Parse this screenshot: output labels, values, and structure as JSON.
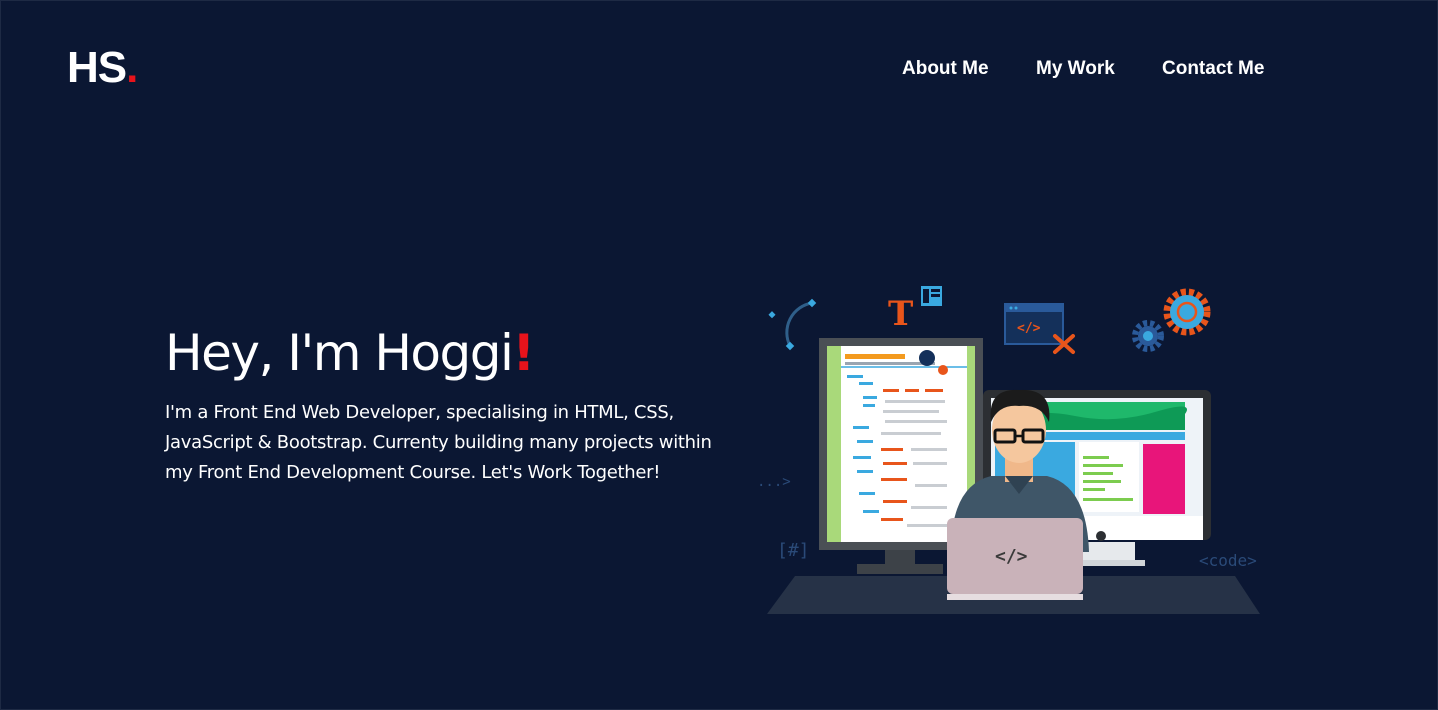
{
  "logo": {
    "text": "HS",
    "dot": "."
  },
  "nav": {
    "items": [
      "About Me",
      "My Work",
      "Contact Me"
    ]
  },
  "hero": {
    "title": "Hey, I'm Hoggi",
    "title_accent": "!",
    "text": "I'm a Front End Web Developer, specialising in HTML, CSS, JavaScript & Bootstrap. Currenty building many projects within my Front End Development Course. Let's Work Together!"
  },
  "illustration": {
    "laptop_code": "</>",
    "screen_code": "</>",
    "tag_code": "<code>",
    "tag_hash": "[#]",
    "tag_dots": "...>",
    "letter": "T"
  },
  "colors": {
    "background": "#0b1733",
    "accent": "#e8131b",
    "text": "#ffffff"
  }
}
